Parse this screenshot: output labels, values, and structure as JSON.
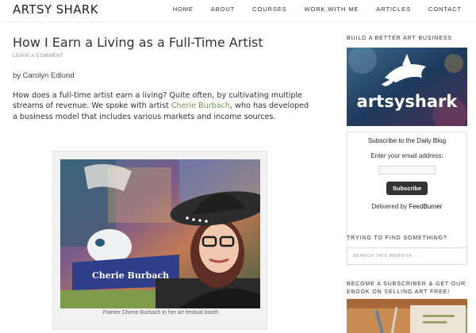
{
  "header": {
    "site_title": "ARTSY SHARK",
    "nav": [
      "HOME",
      "ABOUT",
      "COURSES",
      "WORK WITH ME",
      "ARTICLES",
      "CONTACT"
    ]
  },
  "post": {
    "title": "How I Earn a Living as a Full-Time Artist",
    "meta": "LEAVE A COMMENT",
    "byline": "by Carolyn Edlund",
    "intro_before": "How does a full-time artist earn a living? Quite often, by cultivating multiple streams of revenue. We spoke with artist ",
    "intro_link": "Cherie Burbach",
    "intro_after": ", who has developed a business model that includes various markets and income sources.",
    "image_caption": "Painter Cherie Burbach in her art festival booth",
    "image_sign_text": "Cherie Burbach"
  },
  "sidebar": {
    "widget1_title": "BUILD A BETTER ART BUSINESS",
    "logo_text": "artsyshark",
    "subscribe": {
      "title": "Subscribe to the Daily Blog",
      "label": "Enter your email address:",
      "button": "Subscribe",
      "delivered_prefix": "Delivered by ",
      "delivered_brand": "FeedBurner"
    },
    "widget2_title": "TRYING TO FIND SOMETHING?",
    "search_placeholder": "SEARCH THIS WEBSITE ...",
    "widget3_title": "BECOME A SUBSCRIBER & GET OUR EBOOK ON SELLING ART FREE!"
  },
  "colors": {
    "link": "#6f9a3c",
    "button_bg": "#333333",
    "logo_bg": "#1d3a5c"
  }
}
